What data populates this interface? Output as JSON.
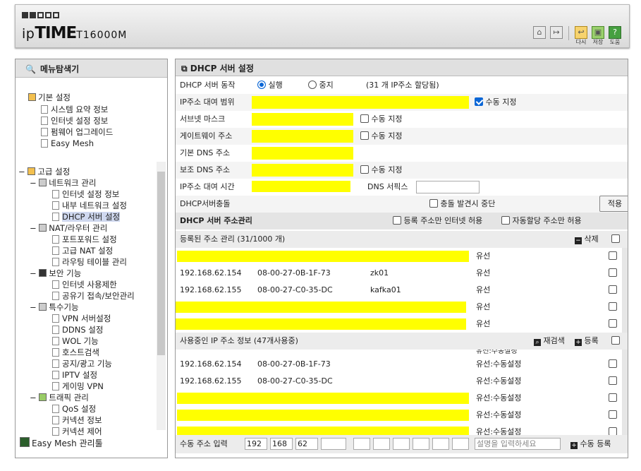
{
  "header": {
    "brand_ip": "ip",
    "brand_time": "TIME",
    "model": "T16000M",
    "icons": [
      "home-icon",
      "logout-icon",
      "reload-icon",
      "save-icon",
      "help-icon"
    ],
    "btn_reload": "다시",
    "btn_save": "저장",
    "btn_help": "도움"
  },
  "sidebar": {
    "title": "메뉴탐색기",
    "basic": {
      "label": "기본 설정",
      "items": [
        "시스템 요약 정보",
        "인터넷 설정 정보",
        "펌웨어 업그레이드",
        "Easy Mesh"
      ]
    },
    "advanced": {
      "label": "고급 설정",
      "network": {
        "label": "네트워크 관리",
        "items": [
          "인터넷 설정 정보",
          "내부 네트워크 설정",
          "DHCP 서버 설정"
        ]
      },
      "nat": {
        "label": "NAT/라우터 관리",
        "items": [
          "포트포워드 설정",
          "고급 NAT 설정",
          "라우팅 테이블 관리"
        ]
      },
      "security": {
        "label": "보안 기능",
        "items": [
          "인터넷 사용제한",
          "공유기 접속/보안관리"
        ]
      },
      "special": {
        "label": "특수기능",
        "items": [
          "VPN 서버설정",
          "DDNS 설정",
          "WOL 기능",
          "호스트검색",
          "공지/광고 기능",
          "IPTV 설정",
          "게이밍 VPN"
        ]
      },
      "traffic": {
        "label": "트래픽 관리",
        "items": [
          "QoS 설정",
          "커넥션 정보",
          "커넥션 제어"
        ]
      }
    },
    "footer": "Easy Mesh 관리툴"
  },
  "main": {
    "title": "DHCP 서버 설정",
    "server_op_label": "DHCP 서버 동작",
    "run": "실행",
    "stop": "중지",
    "assigned": "(31 개 IP주소 할당됨)",
    "ip_range_label": "IP주소 대여 범위",
    "manual": "수동 지정",
    "subnet_label": "서브넷 마스크",
    "gateway_label": "게이트웨이 주소",
    "dns1_label": "기본 DNS 주소",
    "dns2_label": "보조 DNS 주소",
    "lease_label": "IP주소 대여 시간",
    "dns_suffix_label": "DNS 서픽스",
    "conflict_label": "DHCP서버충돌",
    "conflict_stop": "충돌 발견시 중단",
    "apply": "적용",
    "addr_mgmt": "DHCP 서버 주소관리",
    "reg_only": "등록 주소만 인터넷 허용",
    "auto_only": "자동할당 주소만 허용",
    "registered": "등록된 주소 관리 (31/1000 개)",
    "delete": "삭제",
    "reg_rows": [
      {
        "ip": "",
        "mac": "",
        "name": "",
        "type": "유선"
      },
      {
        "ip": "192.168.62.154",
        "mac": "08-00-27-0B-1F-73",
        "name": "zk01",
        "type": "유선"
      },
      {
        "ip": "192.168.62.155",
        "mac": "08-00-27-C0-35-DC",
        "name": "kafka01",
        "type": "유선"
      },
      {
        "ip": "",
        "mac": "",
        "name": "",
        "type": "유선"
      },
      {
        "ip": "",
        "mac": "",
        "name": "",
        "type": "유선"
      }
    ],
    "in_use": "사용중인 IP 주소 정보 (47개사용중)",
    "rescan": "재검색",
    "register": "등록",
    "use_rows": [
      {
        "ip": "192.168.62.154",
        "mac": "08-00-27-0B-1F-73",
        "type": "유선:수동설정"
      },
      {
        "ip": "192.168.62.155",
        "mac": "08-00-27-C0-35-DC",
        "type": "유선:수동설정"
      },
      {
        "ip": "",
        "mac": "",
        "type": "유선:수동설정"
      },
      {
        "ip": "",
        "mac": "",
        "type": "유선:수동설정"
      },
      {
        "ip": "",
        "mac": "",
        "type": "유선:수동설정"
      }
    ],
    "partial_top": "유선:수동설정",
    "manual_input": "수동 주소 입력",
    "ip1": "192",
    "ip2": "168",
    "ip3": "62",
    "desc_placeholder": "설명을 입력하세요",
    "manual_register": "수동 등록"
  }
}
